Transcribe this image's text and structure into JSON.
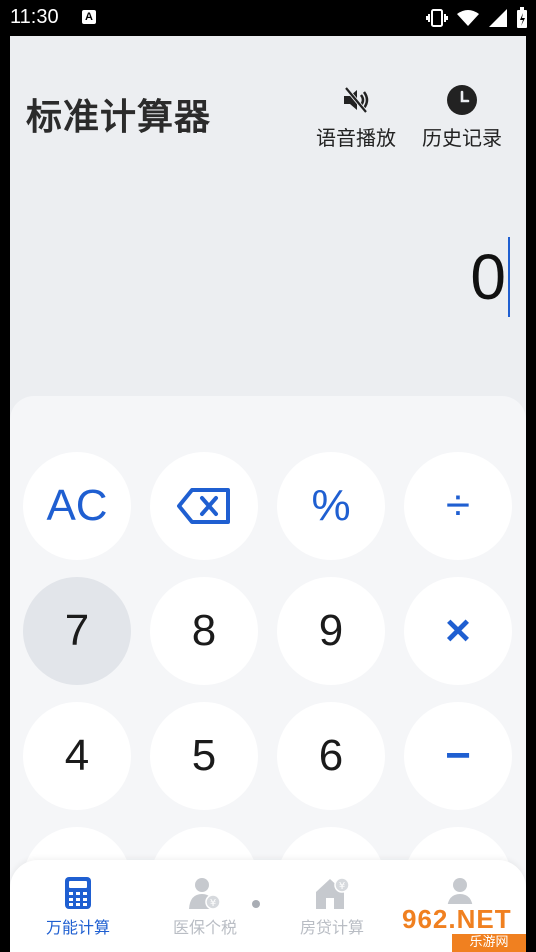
{
  "status_bar": {
    "time": "11:30",
    "notification_badge": "A"
  },
  "header": {
    "title": "标准计算器",
    "voice_label": "语音播放",
    "history_label": "历史记录"
  },
  "display": {
    "value": "0"
  },
  "keys": {
    "row1": [
      "AC",
      "",
      "%",
      "÷"
    ],
    "row2": [
      "7",
      "8",
      "9",
      "×"
    ],
    "row3": [
      "4",
      "5",
      "6",
      "−"
    ]
  },
  "nav": {
    "items": [
      {
        "label": "万能计算",
        "active": true
      },
      {
        "label": "医保个税",
        "active": false
      },
      {
        "label": "房贷计算",
        "active": false
      },
      {
        "label": "",
        "active": false
      }
    ]
  },
  "watermark": {
    "top": "962.NET",
    "bottom": "乐游网"
  },
  "colors": {
    "accent": "#1f5fd1",
    "background": "#eceef1",
    "keypad": "#f5f6f8",
    "inactive": "#b9bdc4"
  }
}
